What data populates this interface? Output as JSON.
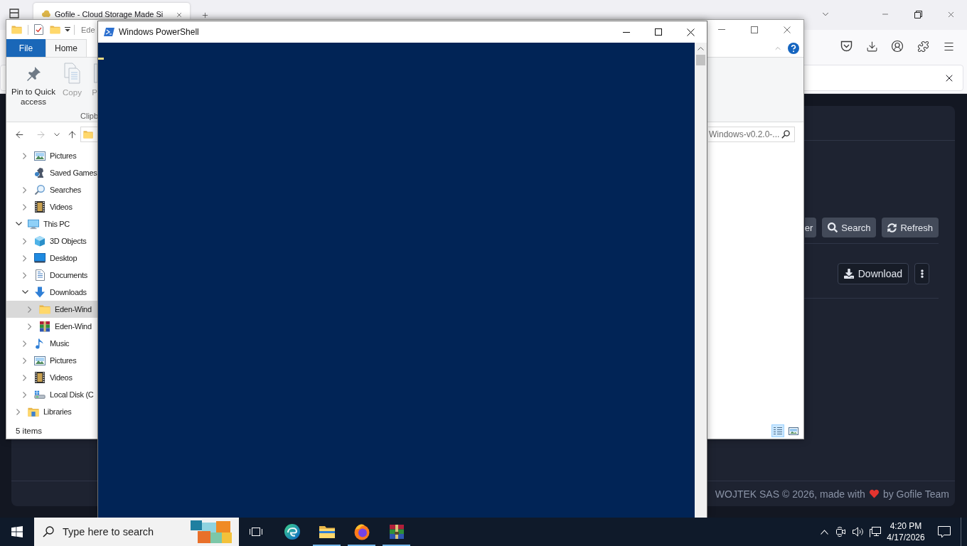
{
  "browser": {
    "tabs": [
      {
        "title": "Gofile - Cloud Storage Made Si",
        "selected": true
      }
    ],
    "page": {
      "toolbar_buttons": [
        {
          "kind": "plain",
          "label": "er"
        },
        {
          "kind": "search",
          "label": "Search"
        },
        {
          "kind": "refresh",
          "label": "Refresh"
        }
      ],
      "download_button": "Download",
      "footer": {
        "before_heart": "WOJTEK SAS © 2026, made with",
        "after_heart": "by Gofile Team"
      }
    }
  },
  "explorer": {
    "title": "Ede",
    "ribbon_tabs": [
      {
        "kind": "backstage",
        "label": "File",
        "selected": false
      },
      {
        "kind": "tab",
        "label": "Home",
        "selected": true
      }
    ],
    "ribbon_commands": [
      {
        "kind": "pin",
        "label": "Pin to Quick access",
        "disabled": false
      },
      {
        "kind": "copy",
        "label": "Copy",
        "disabled": true
      },
      {
        "kind": "paste",
        "label": "P",
        "disabled": true
      }
    ],
    "ribbon_group": "Clipb",
    "search": {
      "placeholder": "Windows-v0.2.0-..."
    },
    "nav_tree": [
      {
        "children": [
          {
            "label": "Pictures",
            "kind": "pictures",
            "expanded": false,
            "selected": false
          },
          {
            "label": "Saved Games",
            "kind": "games",
            "selected": false
          },
          {
            "label": "Searches",
            "kind": "search",
            "expanded": false,
            "selected": false
          },
          {
            "label": "Videos",
            "kind": "videos",
            "expanded": false,
            "selected": false
          }
        ]
      },
      {
        "label": "This PC",
        "kind": "computer",
        "expanded": true,
        "selected": false,
        "children": [
          {
            "label": "3D Objects",
            "kind": "objects3d",
            "expanded": false,
            "selected": false
          },
          {
            "label": "Desktop",
            "kind": "desktop",
            "expanded": false,
            "selected": false
          },
          {
            "label": "Documents",
            "kind": "documents",
            "expanded": false,
            "selected": false
          },
          {
            "label": "Downloads",
            "kind": "downloads",
            "expanded": true,
            "selected": false,
            "children": [
              {
                "label": "Eden-Wind",
                "kind": "folder",
                "expanded": false,
                "selected": true
              },
              {
                "label": "Eden-Wind",
                "kind": "archive",
                "expanded": false,
                "selected": false
              }
            ]
          },
          {
            "label": "Music",
            "kind": "music",
            "expanded": false,
            "selected": false
          },
          {
            "label": "Pictures",
            "kind": "pictures",
            "expanded": false,
            "selected": false
          },
          {
            "label": "Videos",
            "kind": "videos",
            "expanded": false,
            "selected": false
          },
          {
            "label": "Local Disk (C",
            "kind": "disk",
            "expanded": false,
            "selected": false
          }
        ]
      },
      {
        "label": "Libraries",
        "kind": "libraries",
        "expanded": false,
        "selected": false
      }
    ],
    "status": "5 items",
    "views": [
      {
        "kind": "details",
        "selected": true
      },
      {
        "kind": "thumbnails",
        "selected": false
      }
    ]
  },
  "powershell": {
    "title": "Windows PowerShell"
  },
  "taskbar": {
    "search": {
      "placeholder": "Type here to search"
    },
    "apps": [
      {
        "kind": "swirl",
        "running": false
      },
      {
        "kind": "folder",
        "running": true
      },
      {
        "kind": "fox",
        "running": true
      },
      {
        "kind": "books",
        "running": true
      }
    ],
    "clock": {
      "time": "4:20 PM",
      "date": "4/17/2026"
    }
  }
}
